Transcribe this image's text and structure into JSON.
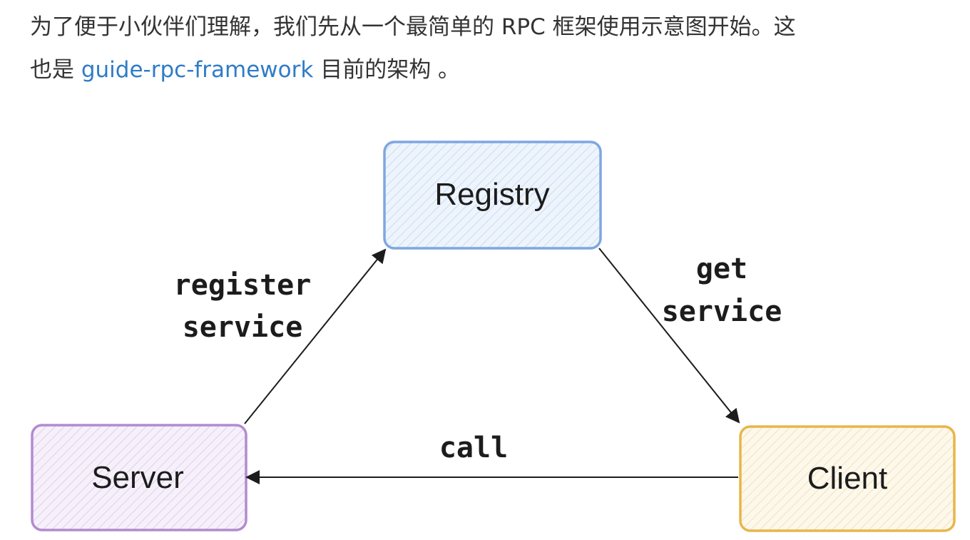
{
  "paragraph": {
    "line1": "为了便于小伙伴们理解，我们先从一个最简单的 RPC 框架使用示意图开始。这",
    "line2_prefix": "也是 ",
    "link_text": "guide-rpc-framework",
    "line2_suffix": " 目前的架构 。"
  },
  "diagram": {
    "nodes": {
      "registry": {
        "label": "Registry",
        "color": "#7ea6e0",
        "fill": "#eaf2fc"
      },
      "server": {
        "label": "Server",
        "color": "#b38bd0",
        "fill": "#f4ecf9"
      },
      "client": {
        "label": "Client",
        "color": "#e8b64a",
        "fill": "#fdf6e6"
      }
    },
    "edges": {
      "register": {
        "line1": "register",
        "line2": "service"
      },
      "get": {
        "line1": "get",
        "line2": "service"
      },
      "call": {
        "label": "call"
      }
    }
  },
  "colors": {
    "text": "#333333",
    "link": "#2f7cc7",
    "arrow": "#1c1c1c"
  }
}
